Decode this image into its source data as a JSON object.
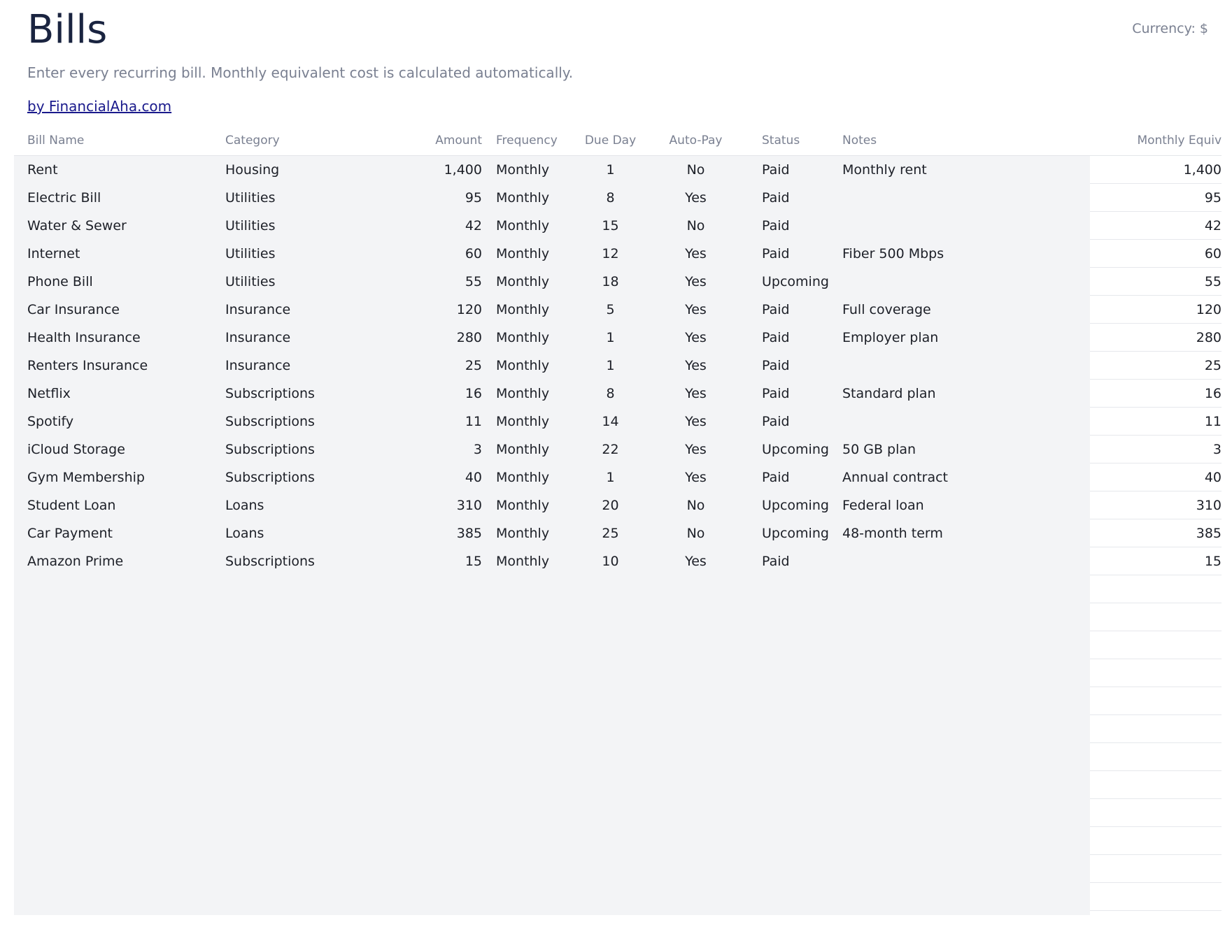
{
  "header": {
    "title": "Bills",
    "currency": "Currency: $",
    "subtitle": "Enter every recurring bill. Monthly equivalent cost is calculated automatically.",
    "credit_link": "by FinancialAha.com"
  },
  "table": {
    "columns": {
      "name": "Bill Name",
      "category": "Category",
      "amount": "Amount",
      "frequency": "Frequency",
      "due_day": "Due Day",
      "auto_pay": "Auto-Pay",
      "status": "Status",
      "notes": "Notes",
      "monthly_equiv": "Monthly Equiv"
    },
    "rows": [
      {
        "name": "Rent",
        "category": "Housing",
        "amount": "1,400",
        "frequency": "Monthly",
        "due_day": "1",
        "auto_pay": "No",
        "status": "Paid",
        "notes": "Monthly rent",
        "monthly_equiv": "1,400"
      },
      {
        "name": "Electric Bill",
        "category": "Utilities",
        "amount": "95",
        "frequency": "Monthly",
        "due_day": "8",
        "auto_pay": "Yes",
        "status": "Paid",
        "notes": "",
        "monthly_equiv": "95"
      },
      {
        "name": "Water & Sewer",
        "category": "Utilities",
        "amount": "42",
        "frequency": "Monthly",
        "due_day": "15",
        "auto_pay": "No",
        "status": "Paid",
        "notes": "",
        "monthly_equiv": "42"
      },
      {
        "name": "Internet",
        "category": "Utilities",
        "amount": "60",
        "frequency": "Monthly",
        "due_day": "12",
        "auto_pay": "Yes",
        "status": "Paid",
        "notes": "Fiber 500 Mbps",
        "monthly_equiv": "60"
      },
      {
        "name": "Phone Bill",
        "category": "Utilities",
        "amount": "55",
        "frequency": "Monthly",
        "due_day": "18",
        "auto_pay": "Yes",
        "status": "Upcoming",
        "notes": "",
        "monthly_equiv": "55"
      },
      {
        "name": "Car Insurance",
        "category": "Insurance",
        "amount": "120",
        "frequency": "Monthly",
        "due_day": "5",
        "auto_pay": "Yes",
        "status": "Paid",
        "notes": "Full coverage",
        "monthly_equiv": "120"
      },
      {
        "name": "Health Insurance",
        "category": "Insurance",
        "amount": "280",
        "frequency": "Monthly",
        "due_day": "1",
        "auto_pay": "Yes",
        "status": "Paid",
        "notes": "Employer plan",
        "monthly_equiv": "280"
      },
      {
        "name": "Renters Insurance",
        "category": "Insurance",
        "amount": "25",
        "frequency": "Monthly",
        "due_day": "1",
        "auto_pay": "Yes",
        "status": "Paid",
        "notes": "",
        "monthly_equiv": "25"
      },
      {
        "name": "Netflix",
        "category": "Subscriptions",
        "amount": "16",
        "frequency": "Monthly",
        "due_day": "8",
        "auto_pay": "Yes",
        "status": "Paid",
        "notes": "Standard plan",
        "monthly_equiv": "16"
      },
      {
        "name": "Spotify",
        "category": "Subscriptions",
        "amount": "11",
        "frequency": "Monthly",
        "due_day": "14",
        "auto_pay": "Yes",
        "status": "Paid",
        "notes": "",
        "monthly_equiv": "11"
      },
      {
        "name": "iCloud Storage",
        "category": "Subscriptions",
        "amount": "3",
        "frequency": "Monthly",
        "due_day": "22",
        "auto_pay": "Yes",
        "status": "Upcoming",
        "notes": "50 GB plan",
        "monthly_equiv": "3"
      },
      {
        "name": "Gym Membership",
        "category": "Subscriptions",
        "amount": "40",
        "frequency": "Monthly",
        "due_day": "1",
        "auto_pay": "Yes",
        "status": "Paid",
        "notes": "Annual contract",
        "monthly_equiv": "40"
      },
      {
        "name": "Student Loan",
        "category": "Loans",
        "amount": "310",
        "frequency": "Monthly",
        "due_day": "20",
        "auto_pay": "No",
        "status": "Upcoming",
        "notes": "Federal loan",
        "monthly_equiv": "310"
      },
      {
        "name": "Car Payment",
        "category": "Loans",
        "amount": "385",
        "frequency": "Monthly",
        "due_day": "25",
        "auto_pay": "No",
        "status": "Upcoming",
        "notes": "48-month term",
        "monthly_equiv": "385"
      },
      {
        "name": "Amazon Prime",
        "category": "Subscriptions",
        "amount": "15",
        "frequency": "Monthly",
        "due_day": "10",
        "auto_pay": "Yes",
        "status": "Paid",
        "notes": "",
        "monthly_equiv": "15"
      }
    ]
  }
}
